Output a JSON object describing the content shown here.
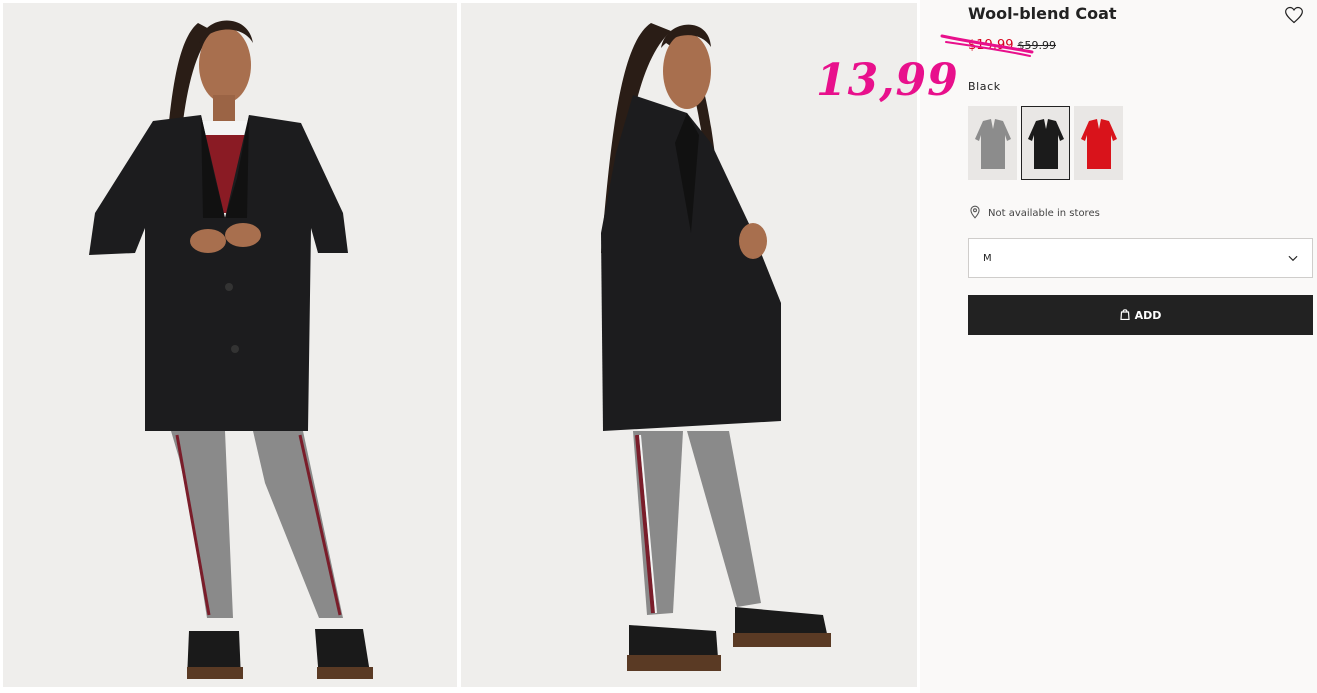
{
  "product": {
    "title": "Wool-blend Coat",
    "sale_price": "$19.99",
    "original_price": "$59.99",
    "annotation_price": "13,99",
    "color_label": "Black",
    "availability": "Not available in stores",
    "selected_size": "M",
    "add_label": "ADD",
    "swatches": [
      {
        "name": "gray",
        "color": "#8c8c8c"
      },
      {
        "name": "black",
        "color": "#1b1b1b"
      },
      {
        "name": "red",
        "color": "#d9131b"
      }
    ]
  },
  "colors": {
    "accent_pink": "#e8108c",
    "sale_red": "#d6001c",
    "button_dark": "#222222",
    "panel_bg": "#faf9f8"
  },
  "icons": {
    "favorite": "heart-icon",
    "location": "location-pin-icon",
    "dropdown": "chevron-down-icon",
    "bag": "shopping-bag-icon"
  }
}
